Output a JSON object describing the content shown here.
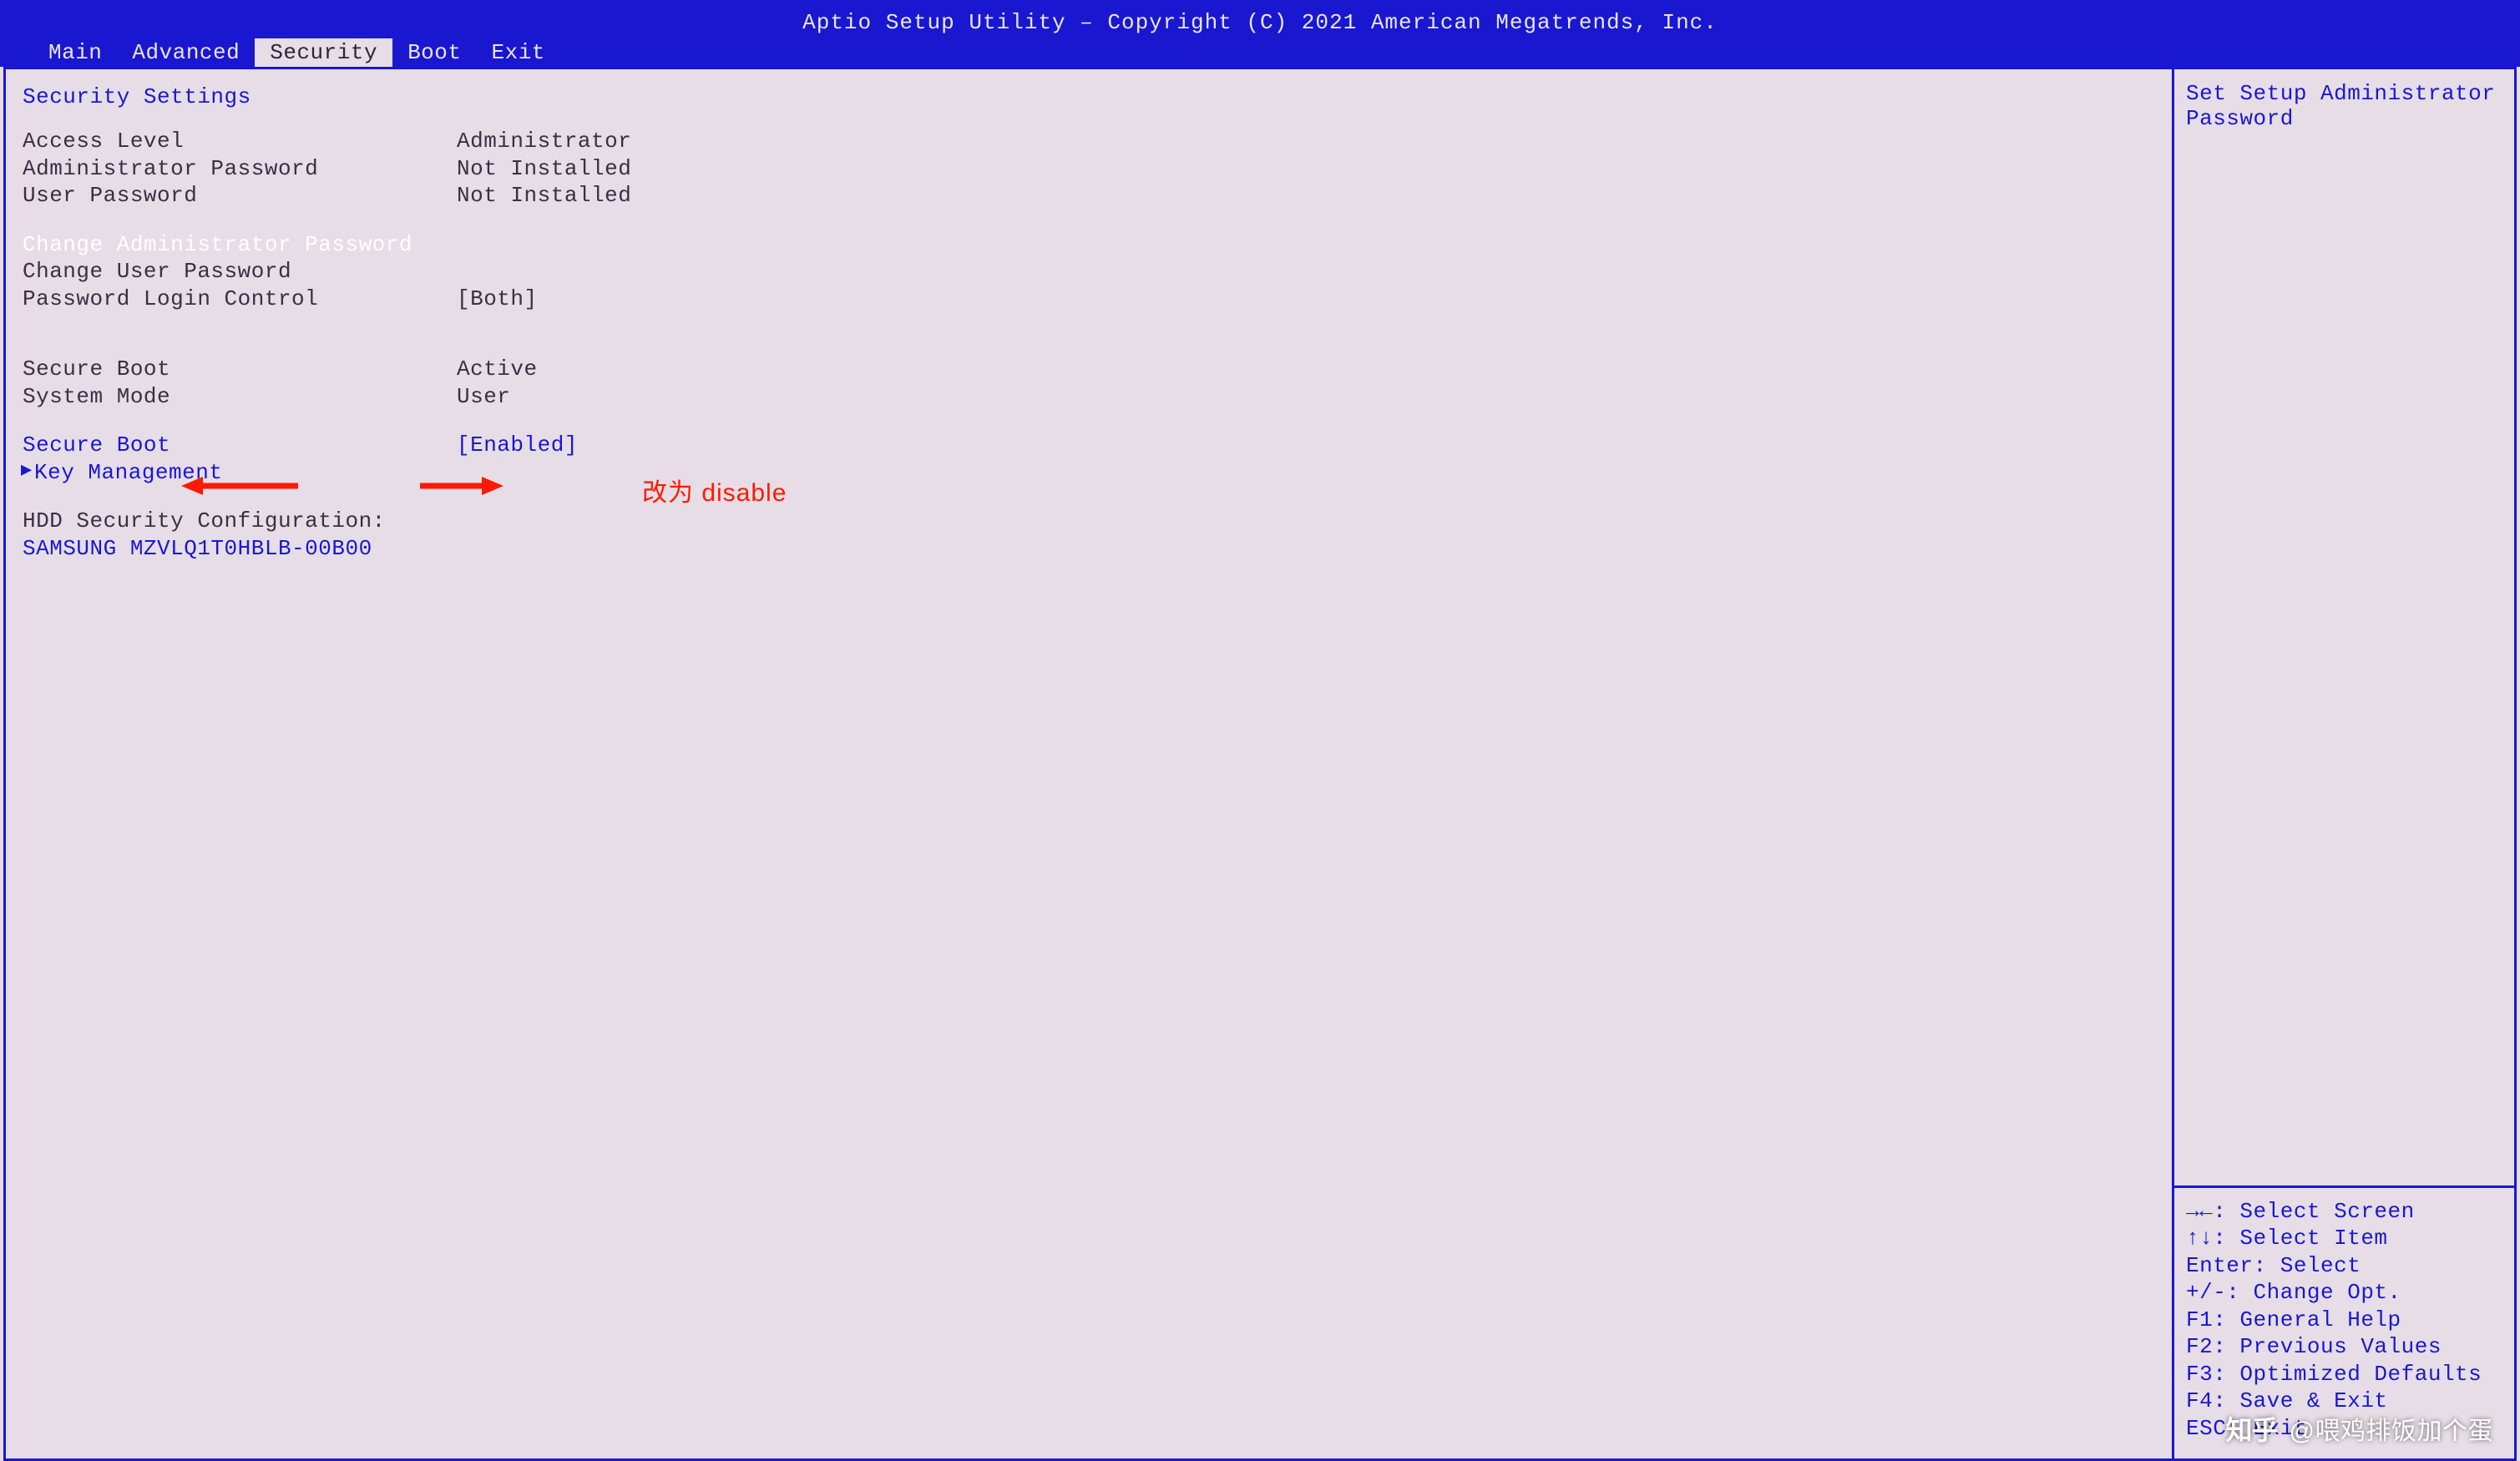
{
  "header": {
    "title": "Aptio Setup Utility – Copyright (C) 2021 American Megatrends, Inc.",
    "tabs": [
      "Main",
      "Advanced",
      "Security",
      "Boot",
      "Exit"
    ],
    "active_tab": "Security"
  },
  "page": {
    "heading": "Security Settings",
    "rows": {
      "access_level": {
        "label": "Access Level",
        "value": "Administrator"
      },
      "admin_pw_status": {
        "label": "Administrator Password",
        "value": "Not Installed"
      },
      "user_pw_status": {
        "label": "User Password",
        "value": "Not Installed"
      },
      "change_admin_pw": {
        "label": "Change Administrator Password"
      },
      "change_user_pw": {
        "label": "Change User Password"
      },
      "pw_login_control": {
        "label": "Password Login Control",
        "value": "[Both]"
      },
      "secure_boot_state": {
        "label": "Secure Boot",
        "value": "Active"
      },
      "system_mode": {
        "label": "System Mode",
        "value": "User"
      },
      "secure_boot_opt": {
        "label": "Secure Boot",
        "value": "[Enabled]"
      },
      "key_management": {
        "label": "Key Management"
      },
      "hdd_sec_heading": {
        "label": "HDD Security Configuration:"
      },
      "hdd_device": {
        "label": "SAMSUNG MZVLQ1T0HBLB-00B00"
      }
    }
  },
  "help": {
    "description": "Set Setup Administrator Password",
    "keys": "→←: Select Screen\n↑↓: Select Item\nEnter: Select\n+/-: Change Opt.\nF1: General Help\nF2: Previous Values\nF3: Optimized Defaults\nF4: Save & Exit\nESC: Exit"
  },
  "annotation": {
    "text": "改为 disable"
  },
  "watermark": {
    "site": "知乎",
    "user": "@喂鸡排饭加个蛋"
  },
  "colors": {
    "bg": "#e6dde6",
    "blue": "#1a17d0",
    "red": "#ff1900"
  }
}
